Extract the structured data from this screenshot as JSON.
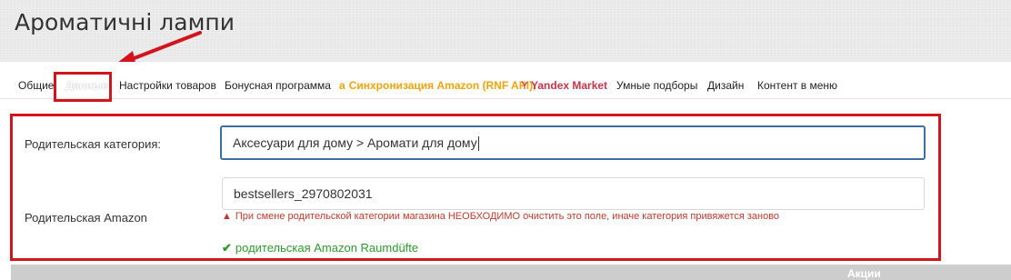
{
  "page": {
    "title": "Ароматичні лампи"
  },
  "tabs": [
    {
      "label": "Общие",
      "active": false
    },
    {
      "label": "Данные",
      "active": true
    },
    {
      "label": "Настройки товаров",
      "active": false
    },
    {
      "label": "Бонусная программа",
      "active": false
    },
    {
      "label": "Синхронизация Amazon (RNF API),",
      "icon": "amazon-icon",
      "icon_glyph": "a",
      "active": false
    },
    {
      "label": "Yandex Market",
      "icon": "yandex-icon",
      "icon_glyph": "Y",
      "active": false
    },
    {
      "label": "Умные подборы",
      "active": false
    },
    {
      "label": "Дизайн",
      "active": false
    },
    {
      "label": "Контент в меню",
      "active": false
    }
  ],
  "form": {
    "parent_category": {
      "label": "Родительская категория:",
      "value": "Аксесуари для дому > Аромати для дому"
    },
    "parent_amazon": {
      "label": "Родительская Amazon",
      "value": "bestsellers_2970802031",
      "warning_icon": "warning-triangle-icon",
      "warning_glyph": "▲",
      "warning": "При смене родительской категории магазина НЕОБХОДИМО очистить это поле, иначе категория привяжется заново",
      "status_icon": "check-icon",
      "status_glyph": "✔",
      "status": "родительская Amazon Raumdüfte"
    }
  },
  "table": {
    "actions_header": "Акции"
  },
  "colors": {
    "highlight": "#d2141c",
    "amazon": "#f0a30a",
    "yandex": "#c8334a",
    "warning": "#c0392b",
    "success": "#2e9a2e",
    "focus_border": "#3c6e9e"
  }
}
